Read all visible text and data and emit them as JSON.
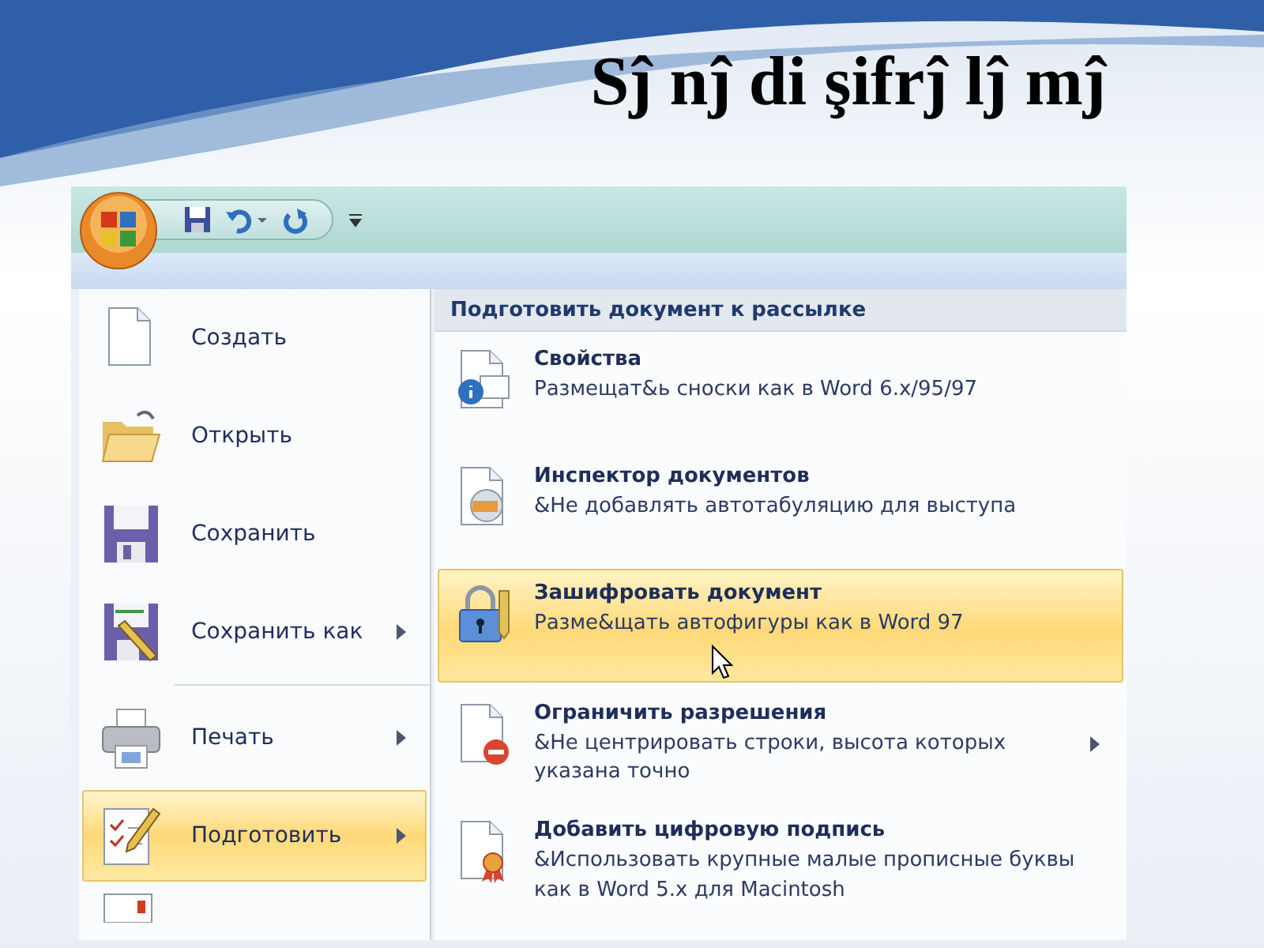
{
  "slide_title": "Sĵ nĵ di şifrĵ lĵ mĵ",
  "file_menu": {
    "items": [
      {
        "label": "Создать",
        "selected": false,
        "has_submenu": false
      },
      {
        "label": "Открыть",
        "selected": false,
        "has_submenu": false
      },
      {
        "label": "Сохранить",
        "selected": false,
        "has_submenu": false
      },
      {
        "label": "Сохранить как",
        "selected": false,
        "has_submenu": true
      },
      {
        "label": "Печать",
        "selected": false,
        "has_submenu": true
      },
      {
        "label": "Подготовить",
        "selected": true,
        "has_submenu": true
      }
    ]
  },
  "submenu": {
    "header": "Подготовить документ к рассылке",
    "items": [
      {
        "title": "Свойства",
        "description": "Размещат&ь сноски как в Word 6.x/95/97",
        "selected": false,
        "has_submenu": false
      },
      {
        "title": "Инспектор документов",
        "description": "&Не добавлять автотабуляцию для выступа",
        "selected": false,
        "has_submenu": false
      },
      {
        "title": "Зашифровать документ",
        "description": "Разме&щать автофигуры как в Word 97",
        "selected": true,
        "has_submenu": false
      },
      {
        "title": "Ограничить разрешения",
        "description": "&Не центрировать строки, высота которых указана точно",
        "selected": false,
        "has_submenu": true
      },
      {
        "title": "Добавить цифровую подпись",
        "description": "&Использовать крупные малые прописные буквы как в Word 5.x для Macintosh",
        "selected": false,
        "has_submenu": false
      }
    ]
  }
}
